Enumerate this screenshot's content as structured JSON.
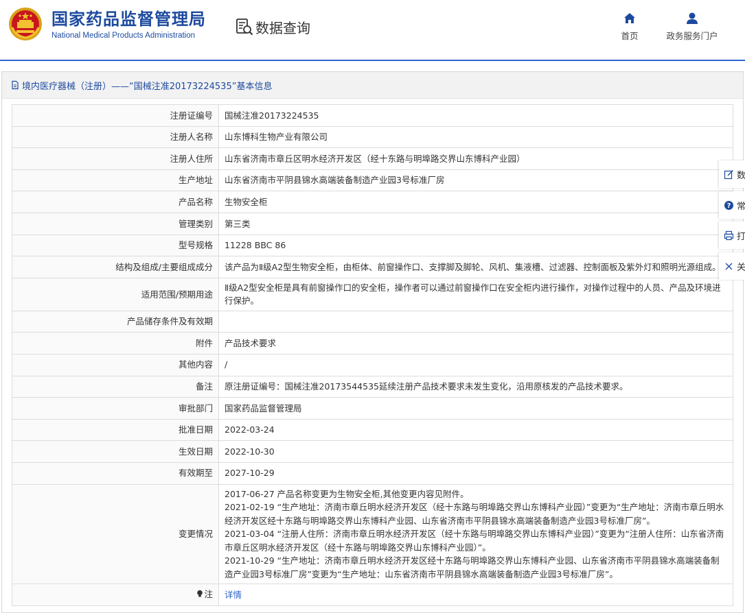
{
  "header": {
    "site_name_cn": "国家药品监督管理局",
    "site_name_en": "National Medical Products Administration",
    "query_title": "数据查询",
    "nav": [
      {
        "label": "首页",
        "icon": "home-icon"
      },
      {
        "label": "政务服务门户",
        "icon": "user-icon"
      }
    ]
  },
  "panel": {
    "title": "境内医疗器械（注册）——“国械注准20173224535”基本信息"
  },
  "rows": [
    {
      "label": "注册证编号",
      "value": "国械注准20173224535"
    },
    {
      "label": "注册人名称",
      "value": "山东博科生物产业有限公司"
    },
    {
      "label": "注册人住所",
      "value": "山东省济南市章丘区明水经济开发区（经十东路与明埠路交界山东博科产业园）"
    },
    {
      "label": "生产地址",
      "value": "山东省济南市平阴县锦水高端装备制造产业园3号标准厂房"
    },
    {
      "label": "产品名称",
      "value": "生物安全柜"
    },
    {
      "label": "管理类别",
      "value": "第三类"
    },
    {
      "label": "型号规格",
      "value": "11228 BBC 86"
    },
    {
      "label": "结构及组成/主要组成成分",
      "value": "该产品为Ⅱ级A2型生物安全柜，由柜体、前窗操作口、支撑脚及脚轮、风机、集液槽、过滤器、控制面板及紫外灯和照明光源组成。"
    },
    {
      "label": "适用范围/预期用途",
      "value": "Ⅱ级A2型安全柜是具有前窗操作口的安全柜，操作者可以通过前窗操作口在安全柜内进行操作，对操作过程中的人员、产品及环境进行保护。"
    },
    {
      "label": "产品储存条件及有效期",
      "value": ""
    },
    {
      "label": "附件",
      "value": "产品技术要求"
    },
    {
      "label": "其他内容",
      "value": "/"
    },
    {
      "label": "备注",
      "value": "原注册证编号：国械注准20173544535延续注册产品技术要求未发生变化，沿用原核发的产品技术要求。"
    },
    {
      "label": "审批部门",
      "value": "国家药品监督管理局"
    },
    {
      "label": "批准日期",
      "value": "2022-03-24"
    },
    {
      "label": "生效日期",
      "value": "2022-10-30"
    },
    {
      "label": "有效期至",
      "value": "2027-10-29"
    }
  ],
  "change": {
    "label": "变更情况",
    "lines": [
      "2017-06-27 产品名称变更为生物安全柜,其他变更内容见附件。",
      "2021-02-19 “生产地址：济南市章丘明水经济开发区（经十东路与明埠路交界山东博科产业园）”变更为“生产地址：济南市章丘明水经济开发区经十东路与明埠路交界山东博科产业园、山东省济南市平阴县锦水高端装备制造产业园3号标准厂房”。",
      "2021-03-04 “注册人住所：济南市章丘明水经济开发区（经十东路与明埠路交界山东博科产业园）”变更为“注册人住所：山东省济南市章丘区明水经济开发区（经十东路与明埠路交界山东博科产业园）”。",
      "2021-10-29 “生产地址：济南市章丘明水经济开发区经十东路与明埠路交界山东博科产业园、山东省济南市平阴县锦水高端装备制造产业园3号标准厂房”变更为“生产地址：山东省济南市平阴县锦水高端装备制造产业园3号标准厂房”。"
    ]
  },
  "note": {
    "label": "注",
    "link": "详情",
    "icon": "bulb-icon"
  },
  "side_tools": [
    {
      "label": "数",
      "icon": "edit-icon"
    },
    {
      "label": "常",
      "icon": "help-icon"
    },
    {
      "label": "打",
      "icon": "print-icon"
    },
    {
      "label": "关",
      "icon": "close-icon"
    }
  ]
}
